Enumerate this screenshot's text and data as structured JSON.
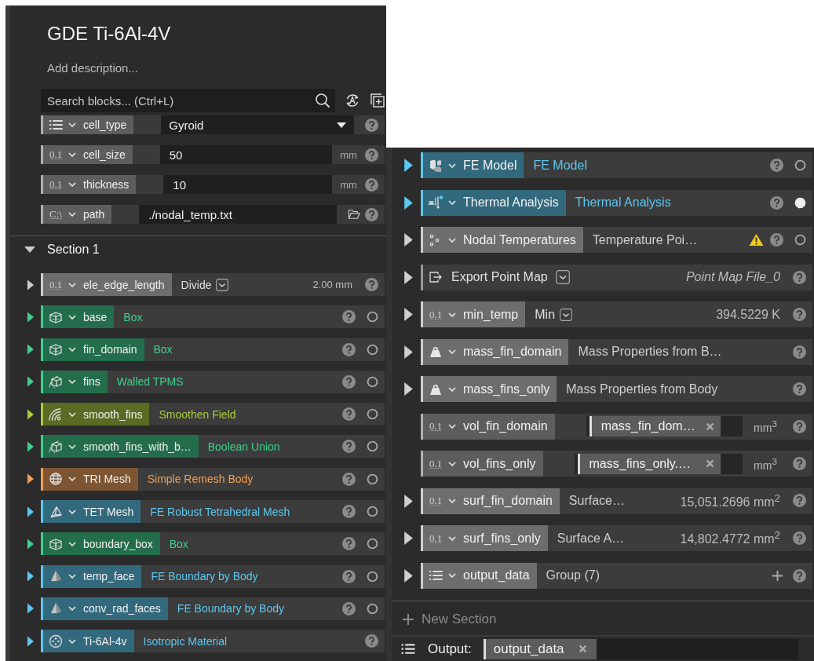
{
  "title": "GDE Ti-6Al-4V",
  "description": {
    "placeholder": "Add description..."
  },
  "search": {
    "placeholder": "Search blocks... (Ctrl+L)"
  },
  "parameters": [
    {
      "kind": "dropdown",
      "name": "cell_type",
      "value": "Gyroid"
    },
    {
      "kind": "number",
      "badge": "0.1",
      "name": "cell_size",
      "value": "50",
      "unit": "mm"
    },
    {
      "kind": "number",
      "badge": "0.1",
      "name": "thickness",
      "value": "10",
      "unit": "mm"
    },
    {
      "kind": "file",
      "badge": "C:\\",
      "name": "path",
      "value": "./nodal_temp.txt"
    }
  ],
  "section": {
    "title": "Section 1",
    "expanded": true,
    "blocks": [
      {
        "kind": "number",
        "expanded": false,
        "color": "#cfcfcf",
        "badge": "0.1",
        "name": "ele_edge_length",
        "op": "Divide",
        "value": "2.00 mm"
      },
      {
        "kind": "primitive",
        "expanded": false,
        "color": "#3ecf8e",
        "name": "base",
        "type": "Box",
        "complete": false
      },
      {
        "kind": "primitive",
        "expanded": false,
        "color": "#3ecf8e",
        "name": "fin_domain",
        "type": "Box",
        "complete": false
      },
      {
        "kind": "lattice",
        "expanded": false,
        "color": "#3ecf8e",
        "name": "fins",
        "type": "Walled TPMS",
        "complete": false
      },
      {
        "kind": "field",
        "expanded": false,
        "color": "#a9cc3c",
        "name": "smooth_fins",
        "type": "Smoothen Field",
        "complete": false
      },
      {
        "kind": "lattice",
        "expanded": false,
        "color": "#3ecf8e",
        "name": "smooth_fins_with_b…",
        "type": "Boolean Union",
        "complete": false
      },
      {
        "kind": "remesh",
        "expanded": false,
        "color": "#f0a05a",
        "name": "TRI Mesh",
        "type": "Simple Remesh Body",
        "complete": false
      },
      {
        "kind": "tet-mesh",
        "expanded": false,
        "color": "#5cc8ef",
        "name": "TET Mesh",
        "type": "FE Robust Tetrahedral Mesh",
        "complete": false
      },
      {
        "kind": "primitive",
        "expanded": false,
        "color": "#3ecf8e",
        "name": "boundary_box",
        "type": "Box",
        "complete": false
      },
      {
        "kind": "fe-boundary",
        "expanded": false,
        "color": "#5cc8ef",
        "name": "temp_face",
        "type": "FE Boundary by Body",
        "complete": false
      },
      {
        "kind": "fe-boundary",
        "expanded": false,
        "color": "#5cc8ef",
        "name": "conv_rad_faces",
        "type": "FE Boundary by Body",
        "complete": false
      },
      {
        "kind": "material",
        "expanded": false,
        "color": "#5cc8ef",
        "name": "Ti-6Al-4v",
        "type": "Isotropic Material"
      }
    ]
  },
  "right_blocks": [
    {
      "kind": "fe-model",
      "expanded": false,
      "color": "#5cc8ef",
      "name": "FE Model",
      "type": "FE Model",
      "complete": false
    },
    {
      "kind": "analysis",
      "expanded": false,
      "color": "#5cc8ef",
      "name": "Thermal Analysis",
      "type": "Thermal Analysis",
      "complete": true
    },
    {
      "kind": "point-data",
      "expanded": false,
      "color": "#cfcfcf",
      "name": "Nodal Temperatures",
      "type": "Temperature Poi…",
      "warning": true,
      "complete": false
    },
    {
      "kind": "export",
      "expanded": false,
      "color": "#cfcfcf",
      "name": "Export Point Map",
      "value": "Point Map File_0"
    },
    {
      "kind": "number",
      "expanded": false,
      "color": "#cfcfcf",
      "badge": "0.1",
      "name": "min_temp",
      "op": "Min",
      "value": "394.5229 K"
    },
    {
      "kind": "mass",
      "expanded": false,
      "color": "#cfcfcf",
      "name": "mass_fin_domain",
      "type": "Mass Properties from B…"
    },
    {
      "kind": "mass",
      "expanded": false,
      "color": "#cfcfcf",
      "name": "mass_fins_only",
      "type": "Mass Properties from Body"
    },
    {
      "kind": "reference",
      "badge": "0.1",
      "name": "vol_fin_domain",
      "ref": "mass_fin_dom…",
      "unit": "mm$^{3}$"
    },
    {
      "kind": "reference",
      "badge": "0.1",
      "name": "vol_fins_only",
      "ref": "mass_fins_only.…",
      "unit": "mm$^{3}$"
    },
    {
      "kind": "number",
      "expanded": false,
      "color": "#cfcfcf",
      "badge": "0.1",
      "name": "surf_fin_domain",
      "type": "Surface…",
      "value": "15,051.2696 mm$^{2}$"
    },
    {
      "kind": "number",
      "expanded": false,
      "color": "#cfcfcf",
      "badge": "0.1",
      "name": "surf_fins_only",
      "type": "Surface A…",
      "value": "14,802.4772 mm$^{2}$"
    },
    {
      "kind": "group",
      "expanded": false,
      "color": "#cfcfcf",
      "name": "output_data",
      "type": "Group (7)",
      "add": true
    }
  ],
  "new_section": "New Section",
  "output": {
    "label": "Output:",
    "tag": "output_data"
  }
}
